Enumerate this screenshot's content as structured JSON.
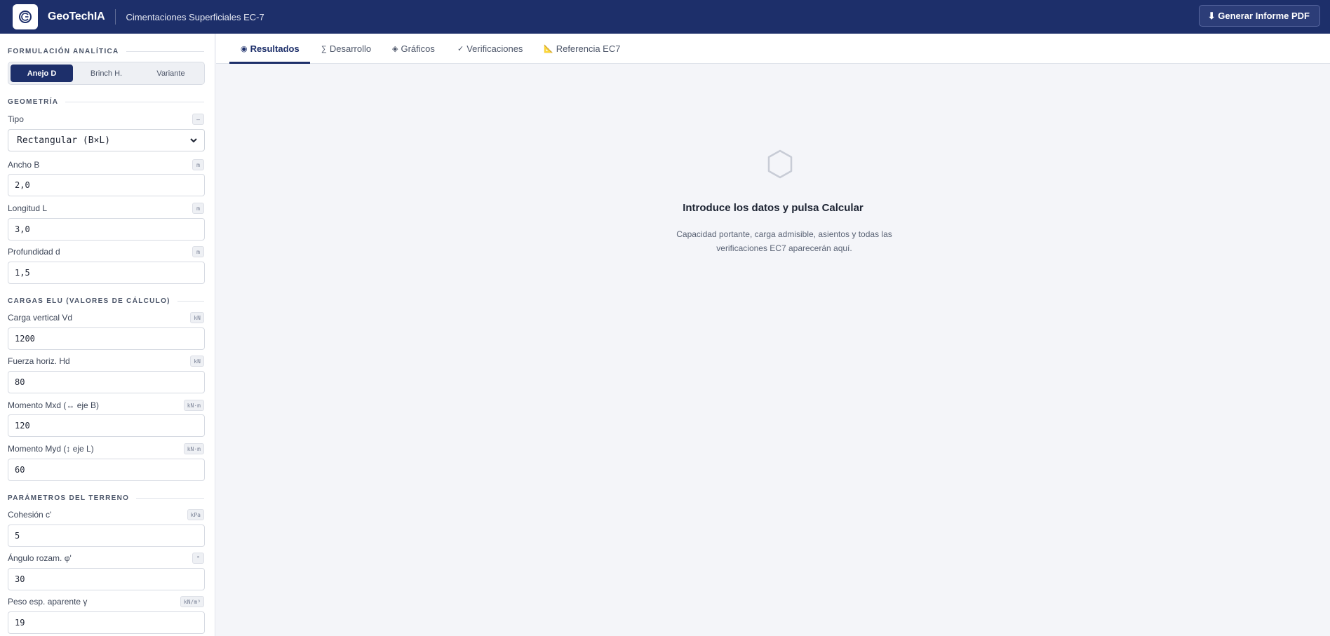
{
  "header": {
    "brand": "GeoTechIA",
    "subtitle": "Cimentaciones Superficiales EC-7",
    "pdf_button": "⬇ Generar Informe PDF"
  },
  "sidebar": {
    "formulation": {
      "title": "FORMULACIÓN ANALÍTICA",
      "options": [
        "Anejo D",
        "Brinch H.",
        "Variante"
      ],
      "selected": "Anejo D"
    },
    "geometry": {
      "title": "GEOMETRÍA",
      "tipo": {
        "label": "Tipo",
        "unit": "–",
        "value": "Rectangular (B×L)"
      },
      "ancho": {
        "label": "Ancho B",
        "unit": "m",
        "value": "2,0"
      },
      "longitud": {
        "label": "Longitud L",
        "unit": "m",
        "value": "3,0"
      },
      "profundidad": {
        "label": "Profundidad d",
        "unit": "m",
        "value": "1,5"
      }
    },
    "loads": {
      "title": "CARGAS ELU (VALORES DE CÁLCULO)",
      "vd": {
        "label": "Carga vertical Vd",
        "unit": "kN",
        "value": "1200"
      },
      "hd": {
        "label": "Fuerza horiz. Hd",
        "unit": "kN",
        "value": "80"
      },
      "mxd": {
        "label": "Momento Mxd (↔ eje B)",
        "unit": "kN·m",
        "value": "120"
      },
      "myd": {
        "label": "Momento Myd (↕ eje L)",
        "unit": "kN·m",
        "value": "60"
      }
    },
    "terrain": {
      "title": "PARÁMETROS DEL TERRENO",
      "cohesion": {
        "label": "Cohesión c'",
        "unit": "kPa",
        "value": "5"
      },
      "phi": {
        "label": "Ángulo rozam. φ'",
        "unit": "°",
        "value": "30"
      },
      "gamma": {
        "label": "Peso esp. aparente γ",
        "unit": "kN/m³",
        "value": "19"
      }
    }
  },
  "tabs": {
    "resultados": {
      "icon": "◉",
      "label": "Resultados"
    },
    "desarrollo": {
      "icon": "∑",
      "label": "Desarrollo"
    },
    "graficos": {
      "icon": "◈",
      "label": "Gráficos"
    },
    "verificaciones": {
      "icon": "✓",
      "label": "Verificaciones"
    },
    "referencia": {
      "icon": "📐",
      "label": "Referencia EC7"
    },
    "active": "Resultados"
  },
  "empty_state": {
    "icon": "hexagon-icon",
    "title": "Introduce los datos y pulsa Calcular",
    "description": "Capacidad portante, carga admisible, asientos y todas las verificaciones EC7 aparecerán aquí."
  },
  "colors": {
    "primary": "#1d2f6a",
    "background": "#f4f5f9"
  }
}
